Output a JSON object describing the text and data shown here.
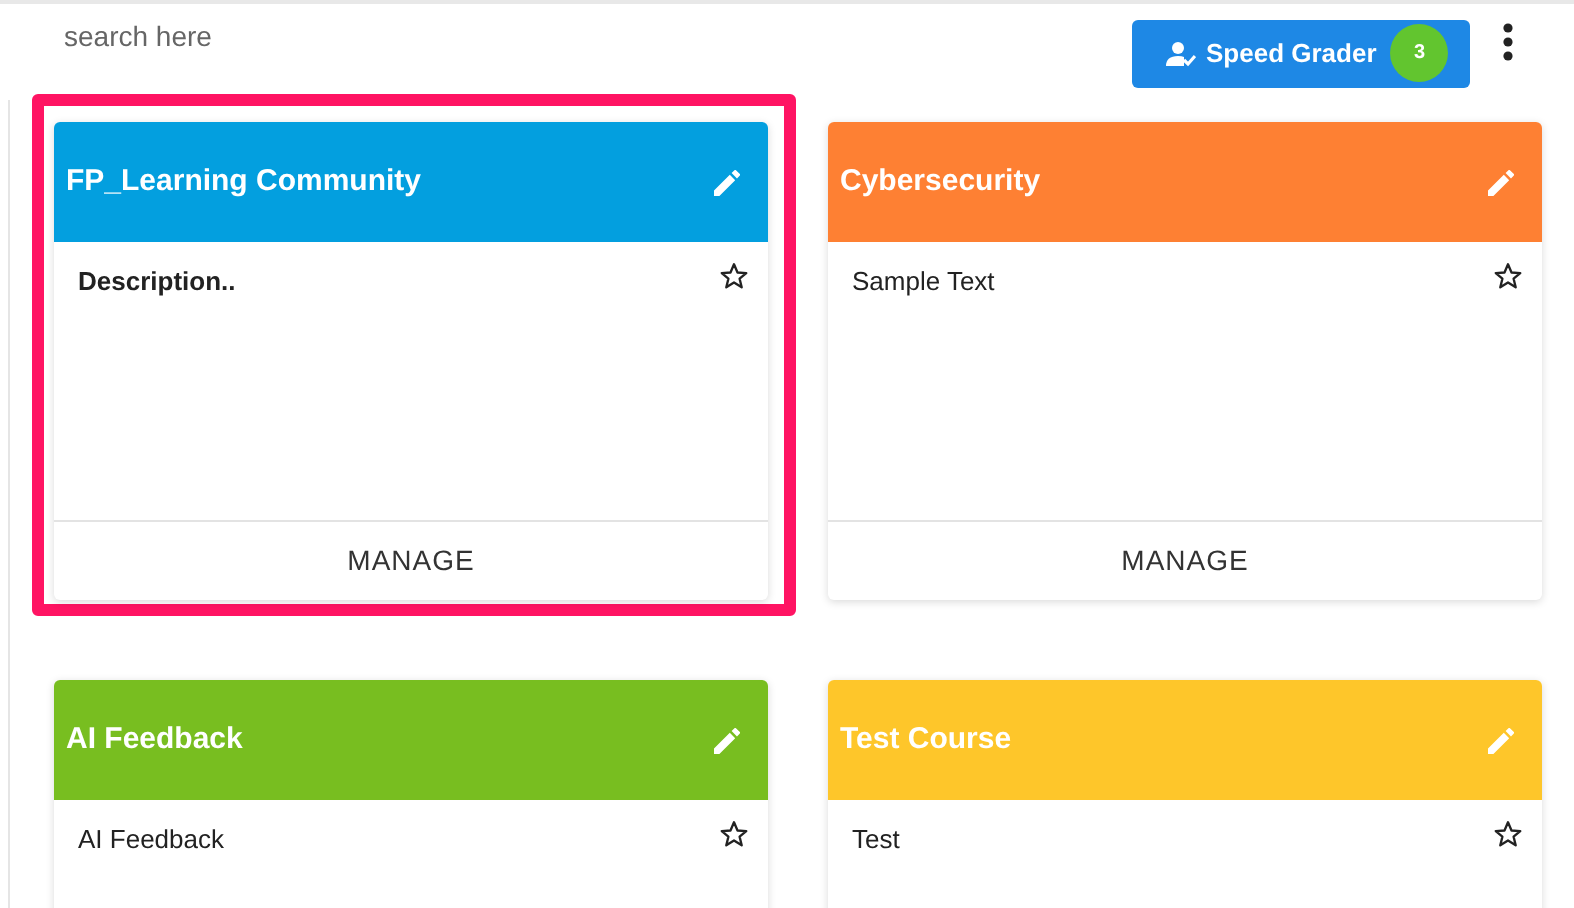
{
  "search": {
    "placeholder": "search here"
  },
  "speed_grader": {
    "label": "Speed Grader",
    "count": "3"
  },
  "courses": [
    {
      "title": "FP_Learning Community",
      "color": "#039fdf",
      "description": "Description..",
      "description_bold": true,
      "starred": false,
      "highlighted": true,
      "action": "MANAGE"
    },
    {
      "title": "Cybersecurity",
      "color": "#fe8033",
      "description": "Sample Text",
      "description_bold": false,
      "starred": false,
      "highlighted": false,
      "action": "MANAGE"
    },
    {
      "title": "AI Feedback",
      "color": "#78be20",
      "description": "AI Feedback",
      "description_bold": false,
      "starred": false,
      "highlighted": false
    },
    {
      "title": "Test Course",
      "color": "#fec62a",
      "description": "Test",
      "description_bold": false,
      "starred": false,
      "highlighted": false
    }
  ]
}
